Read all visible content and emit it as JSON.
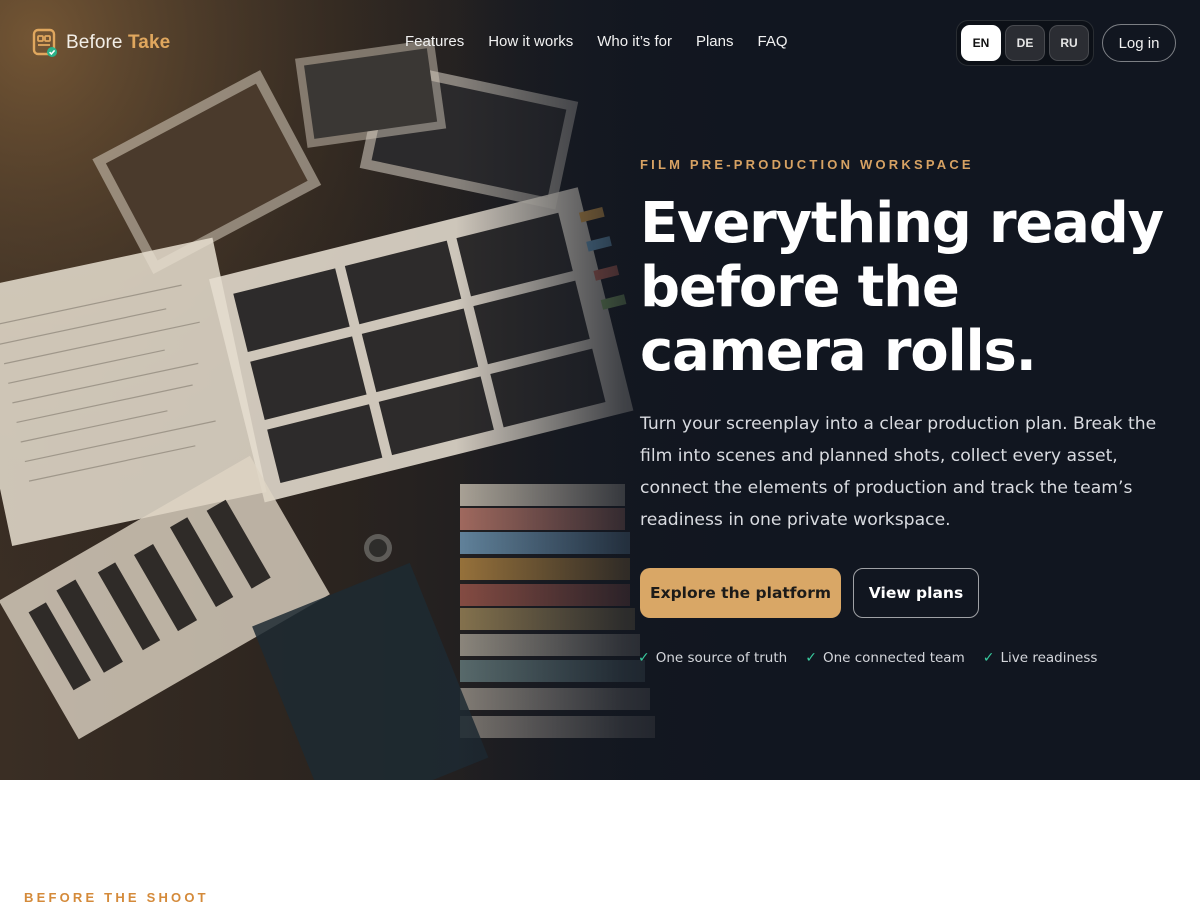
{
  "brand": {
    "name_part1": "Before",
    "name_part2": "Take",
    "icon": "clapperboard-check-icon"
  },
  "nav": {
    "items": [
      {
        "label": "Features"
      },
      {
        "label": "How it works"
      },
      {
        "label": "Who it’s for"
      },
      {
        "label": "Plans"
      },
      {
        "label": "FAQ"
      }
    ],
    "languages": [
      {
        "code": "EN",
        "active": true
      },
      {
        "code": "DE",
        "active": false
      },
      {
        "code": "RU",
        "active": false
      }
    ],
    "login_label": "Log in"
  },
  "hero": {
    "kicker": "FILM PRE-PRODUCTION WORKSPACE",
    "headline": "Everything ready before the camera rolls.",
    "lede": "Turn your screenplay into a clear production plan. Break the film into scenes and planned shots, collect every asset, connect the elements of production and track the team’s readiness in one private workspace.",
    "primary_cta": "Explore the platform",
    "secondary_cta": "View plans",
    "bullets": [
      {
        "check": "✓",
        "text": "One source of truth"
      },
      {
        "check": "✓",
        "text": "One connected team"
      },
      {
        "check": "✓",
        "text": "Live readiness"
      }
    ]
  },
  "next_section": {
    "kicker": "BEFORE THE SHOOT"
  },
  "colors": {
    "accent": "#d9a766",
    "kicker": "#d7a263",
    "check": "#38c99d",
    "hero_bg": "#111620"
  }
}
